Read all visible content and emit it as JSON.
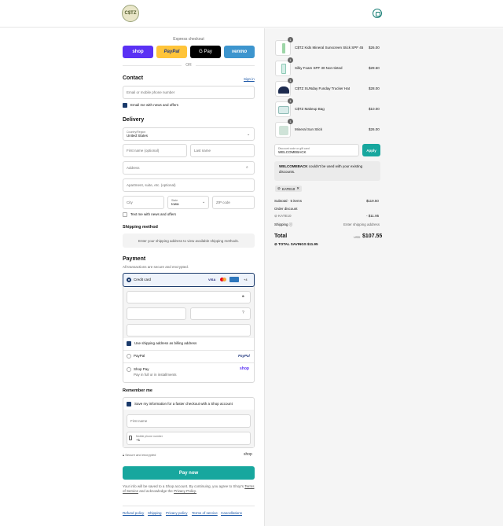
{
  "header": {
    "logo_text": "C$TZ",
    "cart_icon": "bag-icon"
  },
  "express": {
    "label": "Express checkout",
    "shop": "shop",
    "paypal": "PayPal",
    "gpay": "G Pay",
    "venmo": "venmo",
    "or": "OR"
  },
  "contact": {
    "title": "Contact",
    "signin": "Sign in",
    "email_placeholder": "Email or mobile phone number",
    "news_label": "Email me with news and offers"
  },
  "delivery": {
    "title": "Delivery",
    "country_label": "Country/Region",
    "country_value": "United States",
    "first_name": "First name (optional)",
    "last_name": "Last name",
    "address": "Address",
    "apartment": "Apartment, suite, etc. (optional)",
    "city": "City",
    "state_label": "State",
    "state_value": "Iowa",
    "zip": "ZIP code",
    "text_label": "Text me with news and offers"
  },
  "shipping": {
    "title": "Shipping method",
    "message": "Enter your shipping address to view available shipping methods."
  },
  "payment": {
    "title": "Payment",
    "subtitle": "All transactions are secure and encrypted.",
    "credit_card": "Credit card",
    "visa": "VISA",
    "more_cards": "+4",
    "billing_label": "Use shipping address as billing address",
    "paypal": "PayPal",
    "paypal_logo": "PayPal",
    "shop_pay": "Shop Pay",
    "shop_pay_sub": "Pay in full or in installments",
    "shop_logo": "shop"
  },
  "remember": {
    "title": "Remember me",
    "save_label": "Save my information for a faster checkout with a Shop account",
    "first_name": "First name",
    "phone_label": "Mobile phone number",
    "phone_value": "+1",
    "secure_label": "Secure and encrypted",
    "shop_logo": "shop"
  },
  "pay_now": "Pay now",
  "legal": {
    "text": "Your info will be saved to a Shop account. By continuing, you agree to Shop's",
    "tos": "Terms of Service",
    "and": "and acknowledge the",
    "privacy": "Privacy Policy."
  },
  "footer": {
    "refund": "Refund policy",
    "shipping": "Shipping",
    "privacy": "Privacy policy",
    "terms": "Terms of service",
    "cancellations": "Cancellations"
  },
  "cart": {
    "items": [
      {
        "qty": "1",
        "name": "C$TZ Kids Mineral Sunscreen Stick SPF 45",
        "price": "$26.00"
      },
      {
        "qty": "1",
        "name": "Silky Foam SPF 30 Non-tinted",
        "price": "$29.50"
      },
      {
        "qty": "1",
        "name": "C$TZ SUNday Funday Trucker Hat",
        "price": "$28.00"
      },
      {
        "qty": "1",
        "name": "C$TZ Makeup Bag",
        "price": "$10.00"
      },
      {
        "qty": "1",
        "name": "Mineral Sun Stick",
        "price": "$26.00"
      }
    ],
    "discount_label": "Discount code or gift card",
    "discount_value": "WELCOMEBACK",
    "apply": "Apply",
    "error_code": "WELCOMEBACK",
    "error_text": "couldn't be used with your existing discounts.",
    "chip": "KATE10",
    "subtotal_label": "Subtotal · 5 items",
    "subtotal_value": "$119.50",
    "order_discount": "Order discount",
    "discount_code": "KATE10",
    "discount_amount": "- $11.95",
    "shipping_label": "Shipping",
    "shipping_value": "Enter shipping address",
    "total_label": "Total",
    "currency": "USD",
    "total_value": "$107.55",
    "savings_label": "TOTAL SAVINGS",
    "savings_value": "$11.95"
  }
}
